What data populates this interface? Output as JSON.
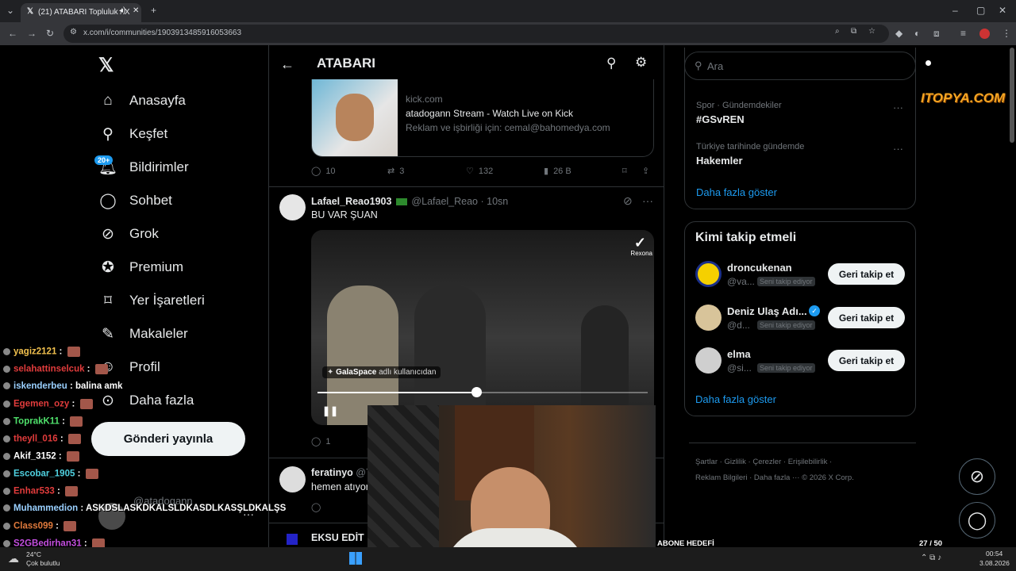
{
  "browser": {
    "tab_title": "(21) ATABARI Topluluk / X",
    "url": "x.com/i/communities/1903913485916053663"
  },
  "nav": {
    "badge": "20+",
    "items": [
      "Anasayfa",
      "Keşfet",
      "Bildirimler",
      "Sohbet",
      "Grok",
      "Premium",
      "Yer İşaretleri",
      "Makaleler",
      "Profil",
      "Daha fazla"
    ],
    "post_button": "Gönderi yayınla",
    "account_handle": "@atadogann"
  },
  "header": {
    "title": "ATABARI"
  },
  "link_card": {
    "domain": "kick.com",
    "title": "atadogann Stream - Watch Live on Kick",
    "desc": "Reklam ve işbirliği için: cemal@bahomedya.com"
  },
  "tweet1_actions": {
    "replies": "10",
    "retweets": "3",
    "likes": "132",
    "views": "26 B"
  },
  "tweet2": {
    "name": "Lafael_Reao1903",
    "handle": "@Lafael_Reao",
    "time": "· 10sn",
    "text": "BU VAR ŞUAN",
    "video_label_user": "GalaSpace",
    "video_label_rest": "adlı kullanıcıdan",
    "watermark": "Rexona",
    "progress": 0.48,
    "replies": "1"
  },
  "tweet3": {
    "name": "feratinyo",
    "handle": "@7",
    "text": "hemen atıyor"
  },
  "tweet4": {
    "name": "EKSU EDİT"
  },
  "search": {
    "placeholder": "Ara"
  },
  "trends": [
    {
      "meta": "Spor · Gündemdekiler",
      "title": "#GSvREN"
    },
    {
      "meta": "Türkiye tarihinde gündemde",
      "title": "Hakemler"
    }
  ],
  "show_more": "Daha fazla göster",
  "who_to_follow": {
    "title": "Kimi takip etmeli",
    "follows_you": "Seni takip ediyor",
    "button": "Geri takip et",
    "users": [
      {
        "name": "droncukenan",
        "handle": "@va..."
      },
      {
        "name": "Deniz Ulaş Adı...",
        "handle": "@d..."
      },
      {
        "name": "elma",
        "handle": "@si..."
      }
    ]
  },
  "footer": {
    "line1": [
      "Şartlar",
      "Gizlilik",
      "Çerezler",
      "Erişilebilirlik"
    ],
    "line2": [
      "Reklam Bilgileri",
      "Daha fazla ···",
      "© 2026 X Corp."
    ]
  },
  "stream": {
    "watermark": "ITOPYA.COM",
    "goal_label": "ABONE HEDEFİ",
    "goal_count": "27 / 50",
    "goal_fraction": 0.54
  },
  "chat": [
    {
      "user": "yagiz2121",
      "msg": "",
      "color": "#f2c14e"
    },
    {
      "user": "selahattinselcuk",
      "msg": "",
      "color": "#e23c3c"
    },
    {
      "user": "iskenderbeu",
      "msg": "balina amk",
      "color": "#9ad0ff"
    },
    {
      "user": "Egemen_ozy",
      "msg": "",
      "color": "#e23c3c"
    },
    {
      "user": "ToprakK11",
      "msg": "",
      "color": "#4fe06b"
    },
    {
      "user": "theyll_016",
      "msg": "",
      "color": "#e23c3c"
    },
    {
      "user": "Akif_3152",
      "msg": "",
      "color": "#ffffff"
    },
    {
      "user": "Escobar_1905",
      "msg": "",
      "color": "#4fd1e0"
    },
    {
      "user": "Enhar533",
      "msg": "",
      "color": "#e23c3c"
    },
    {
      "user": "Muhammedion",
      "msg": "ASKDSLASKDKALSLDKASDLKASŞLDKALŞS",
      "color": "#9ad0ff"
    },
    {
      "user": "Class099",
      "msg": "",
      "color": "#e07a3c"
    },
    {
      "user": "S2GBedirhan31",
      "msg": "",
      "color": "#c44fe0"
    }
  ],
  "taskbar": {
    "temp": "24°C",
    "weather": "Çok bulutlu",
    "time": "00:54",
    "date": "3.08.2026"
  }
}
